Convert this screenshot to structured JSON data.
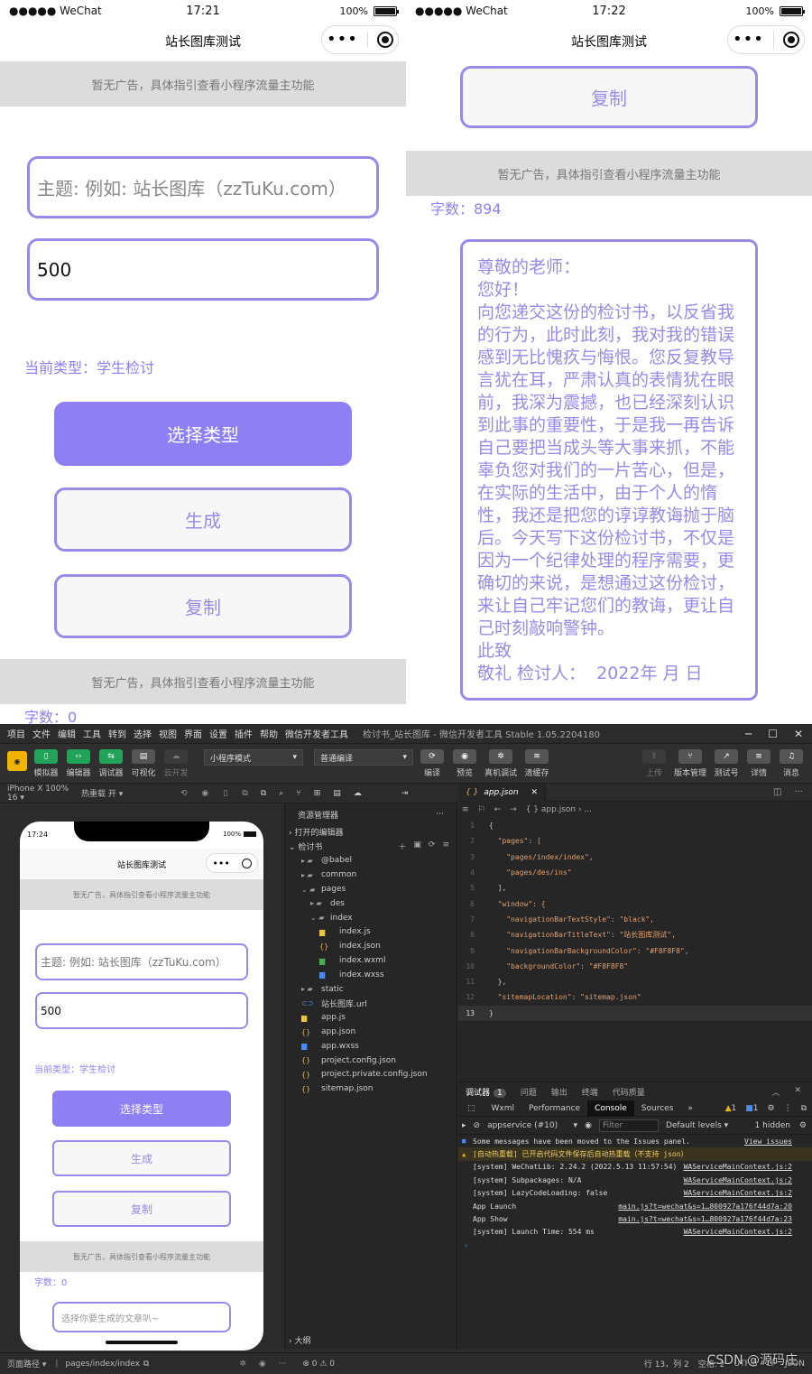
{
  "left_phone": {
    "status": {
      "carrier": "●●●●● WeChat",
      "time": "17:21",
      "battery": "100%"
    },
    "nav_title": "站长图库测试",
    "ad_text": "暂无广告，具体指引查看小程序流量主功能",
    "topic_placeholder": "主题: 例如: 站长图库（zzTuKu.com）",
    "count_value": "500",
    "current_type": "当前类型：学生检讨",
    "btn_select": "选择类型",
    "btn_generate": "生成",
    "btn_copy": "复制",
    "ad_text2": "暂无广告，具体指引查看小程序流量主功能",
    "word_count": "字数：0"
  },
  "right_phone": {
    "status": {
      "carrier": "●●●●● WeChat",
      "time": "17:22",
      "battery": "100%"
    },
    "nav_title": "站长图库测试",
    "btn_copy": "复制",
    "ad_text": "暂无广告，具体指引查看小程序流量主功能",
    "word_count": "字数：894",
    "letter": "尊敬的老师：\n您好！\n向您递交这份的检讨书，以反省我的行为，此时此刻，我对我的错误感到无比愧疚与悔恨。您反复教导言犹在耳，严肃认真的表情犹在眼前，我深为震撼，也已经深刻认识到此事的重要性，于是我一再告诉自己要把当成头等大事来抓，不能辜负您对我们的一片苦心，但是，在实际的生活中，由于个人的惰性，我还是把您的谆谆教诲抛于脑后。今天写下这份检讨书，不仅是因为一个纪律处理的程序需要，更确切的来说，是想通过这份检讨，来让自己牢记您们的教诲，更让自己时刻敲响警钟。\n此致\n敬礼 检讨人：  2022年 月 日"
  },
  "ide": {
    "menu": [
      "项目",
      "文件",
      "编辑",
      "工具",
      "转到",
      "选择",
      "视图",
      "界面",
      "设置",
      "插件",
      "帮助",
      "微信开发者工具"
    ],
    "window_title": "检讨书_站长图库 - 微信开发者工具 Stable 1.05.2204180",
    "toolbar": {
      "left": [
        "模拟器",
        "编辑器",
        "调试器",
        "可视化",
        "云开发"
      ],
      "mode": "小程序模式",
      "compile": "普通编译",
      "mid": [
        "编译",
        "预览",
        "真机调试",
        "清缓存"
      ],
      "right": [
        "上传",
        "版本管理",
        "测试号",
        "详情",
        "消息"
      ]
    },
    "device": "iPhone X 100% 16 ▾",
    "hot_reload": "热重载 开 ▾",
    "sim": {
      "time": "17:24",
      "battery": "100%",
      "nav_title": "站长图库测试",
      "ad": "暂无广告，具体指引查看小程序流量主功能",
      "topic_placeholder": "主题: 例如: 站长图库（zzTuKu.com）",
      "count": "500",
      "current_type": "当前类型：学生检讨",
      "btn_select": "选择类型",
      "btn_generate": "生成",
      "btn_copy": "复制",
      "ad2": "暂无广告，具体指引查看小程序流量主功能",
      "word_count": "字数：0",
      "article_placeholder": "选择你要生成的文章叭~"
    },
    "explorer": {
      "title": "资源管理器",
      "open_editors": "› 打开的编辑器",
      "project": "⌄ 检讨书",
      "tree": [
        {
          "label": "@babel",
          "indent": 1,
          "icon": "folder"
        },
        {
          "label": "common",
          "indent": 1,
          "icon": "folder"
        },
        {
          "label": "pages",
          "indent": 1,
          "icon": "folder-open"
        },
        {
          "label": "des",
          "indent": 2,
          "icon": "folder"
        },
        {
          "label": "index",
          "indent": 2,
          "icon": "folder-open"
        },
        {
          "label": "index.js",
          "indent": 3,
          "icon": "js"
        },
        {
          "label": "index.json",
          "indent": 3,
          "icon": "json"
        },
        {
          "label": "index.wxml",
          "indent": 3,
          "icon": "wxml"
        },
        {
          "label": "index.wxss",
          "indent": 3,
          "icon": "wxss"
        },
        {
          "label": "static",
          "indent": 1,
          "icon": "folder"
        },
        {
          "label": "站长图库.url",
          "indent": 1,
          "icon": "link"
        },
        {
          "label": "app.js",
          "indent": 1,
          "icon": "js"
        },
        {
          "label": "app.json",
          "indent": 1,
          "icon": "json"
        },
        {
          "label": "app.wxss",
          "indent": 1,
          "icon": "wxss"
        },
        {
          "label": "project.config.json",
          "indent": 1,
          "icon": "json"
        },
        {
          "label": "project.private.config.json",
          "indent": 1,
          "icon": "json"
        },
        {
          "label": "sitemap.json",
          "indent": 1,
          "icon": "json"
        }
      ],
      "outline": "› 大纲"
    },
    "editor": {
      "tab": "app.json",
      "breadcrumb": "{ } app.json › ...",
      "lines": [
        {
          "n": "1",
          "t": "{"
        },
        {
          "n": "2",
          "t": "  \"pages\": ["
        },
        {
          "n": "3",
          "t": "    \"pages/index/index\","
        },
        {
          "n": "4",
          "t": "    \"pages/des/ins\""
        },
        {
          "n": "5",
          "t": "  ],"
        },
        {
          "n": "6",
          "t": "  \"window\": {"
        },
        {
          "n": "7",
          "t": "    \"navigationBarTextStyle\": \"black\","
        },
        {
          "n": "8",
          "t": "    \"navigationBarTitleText\": \"站长图库测试\","
        },
        {
          "n": "9",
          "t": "    \"navigationBarBackgroundColor\": \"#F8F8F8\","
        },
        {
          "n": "10",
          "t": "    \"backgroundColor\": \"#F8F8F8\""
        },
        {
          "n": "11",
          "t": "  },"
        },
        {
          "n": "12",
          "t": "  \"sitemapLocation\": \"sitemap.json\""
        },
        {
          "n": "13",
          "t": "}"
        }
      ]
    },
    "console": {
      "tabs": [
        "调试器",
        "问题",
        "输出",
        "终端",
        "代码质量"
      ],
      "badge": "1",
      "devtabs": [
        "Wxml",
        "Performance",
        "Console",
        "Sources",
        "»"
      ],
      "warn_count": "1",
      "info_count": "1",
      "context": "appservice (#10)",
      "filter_placeholder": "Filter",
      "levels": "Default levels ▾",
      "hidden": "1 hidden",
      "rows": [
        {
          "text": "Some messages have been moved to the Issues panel.",
          "link": "View issues",
          "warn": false
        },
        {
          "text": "[自动热重载] 已开启代码文件保存后自动热重载（不支持 json）",
          "link": "",
          "warn": true
        },
        {
          "text": "[system] WeChatLib: 2.24.2 (2022.5.13 11:57:54)",
          "link": "WAServiceMainContext.js:2",
          "warn": false
        },
        {
          "text": "[system] Subpackages: N/A",
          "link": "WAServiceMainContext.js:2",
          "warn": false
        },
        {
          "text": "[system] LazyCodeLoading: false",
          "link": "WAServiceMainContext.js:2",
          "warn": false
        },
        {
          "text": "App Launch",
          "link": "main.js?t=wechat&s=1…800927a176f44d7a:20",
          "warn": false
        },
        {
          "text": "App Show",
          "link": "main.js?t=wechat&s=1…800927a176f44d7a:23",
          "warn": false
        },
        {
          "text": "[system] Launch Time: 554 ms",
          "link": "WAServiceMainContext.js:2",
          "warn": false
        }
      ]
    },
    "statusbar": {
      "path_label": "页面路径 ▾",
      "path": "pages/index/index",
      "errors": "⊗ 0 ⚠ 0",
      "cursor": "行 13，列 2",
      "spaces": "空格: 2",
      "enc": "UTF-8",
      "lf": "LF",
      "lang": "JSON",
      "watermark": "CSDN @源码庄"
    }
  }
}
